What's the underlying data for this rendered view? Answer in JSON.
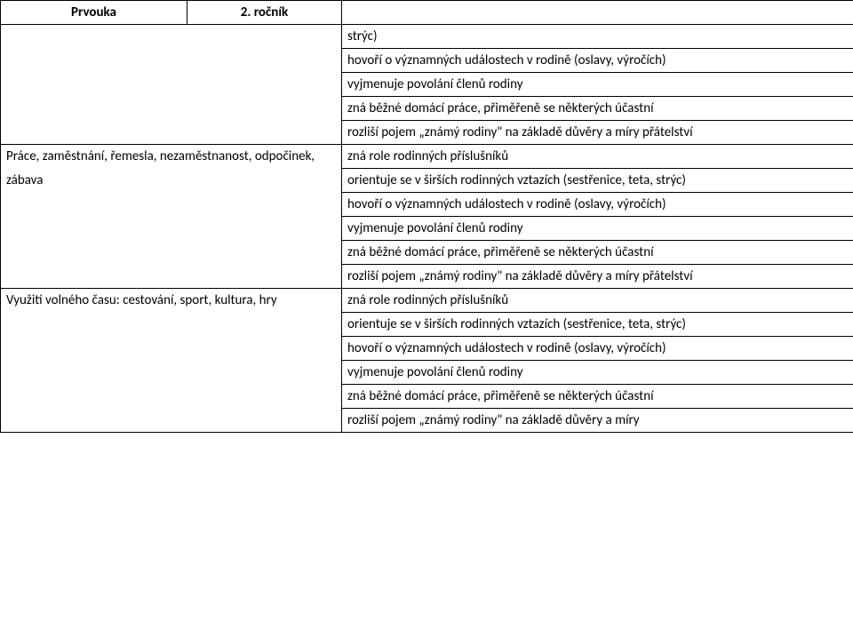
{
  "header": {
    "subject": "Prvouka",
    "grade": "2. ročník"
  },
  "rows": {
    "r0": {
      "right": "strýc)"
    },
    "r1": {
      "right": "hovoří o významných událostech v rodině (oslavy, výročích)"
    },
    "r2": {
      "right": "vyjmenuje povolání členů rodiny"
    },
    "r3": {
      "right": "zná běžné domácí práce, přiměřeně se některých účastní"
    },
    "r4": {
      "right": "rozliší pojem „známý rodiny\" na základě důvěry a míry přátelství"
    },
    "r5": {
      "left_a": "Práce, zaměstnání, řemesla, nezaměstnanost, odpočinek,",
      "right": "zná role rodinných příslušníků"
    },
    "r6": {
      "left_b": "zábava",
      "right": "orientuje se v širších rodinných vztazích (sestřenice, teta, strýc)"
    },
    "r7": {
      "right": "hovoří o významných událostech v rodině (oslavy, výročích)"
    },
    "r8": {
      "right": "vyjmenuje povolání členů rodiny"
    },
    "r9": {
      "right": "zná běžné domácí práce, přiměřeně se některých účastní"
    },
    "r10": {
      "right": "rozliší pojem „známý rodiny\" na základě důvěry a míry přátelství"
    },
    "r11": {
      "left": "Využití volného času: cestování, sport, kultura, hry",
      "right": "zná role rodinných příslušníků"
    },
    "r12": {
      "right": "orientuje se v širších rodinných vztazích (sestřenice, teta, strýc)"
    },
    "r13": {
      "right": "hovoří o významných událostech v rodině (oslavy, výročích)"
    },
    "r14": {
      "right": "vyjmenuje povolání členů rodiny"
    },
    "r15": {
      "right": "zná běžné domácí práce, přiměřeně se některých účastní"
    },
    "r16": {
      "right": "rozliší pojem „známý rodiny\" na základě důvěry a míry"
    }
  }
}
